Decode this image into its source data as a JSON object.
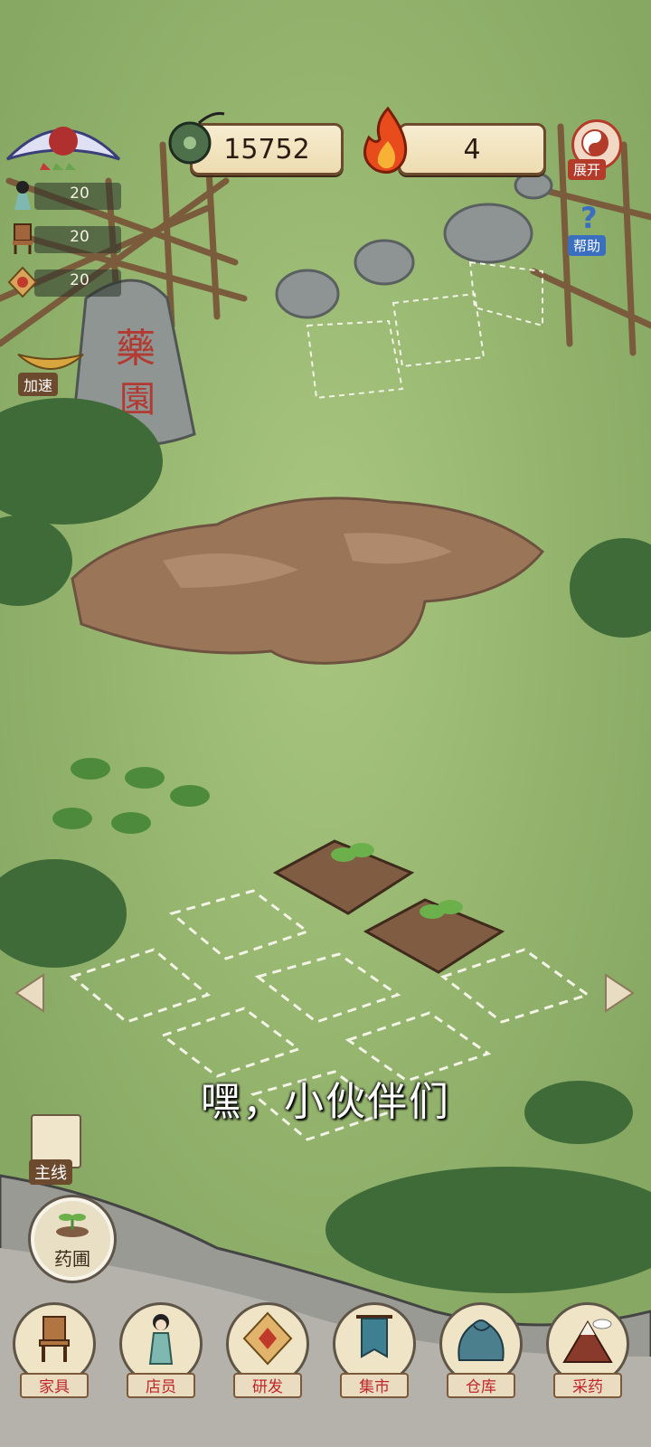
{
  "hud": {
    "coins": "15752",
    "energy": "4",
    "expand_label": "展开",
    "help_label": "帮助"
  },
  "stats": [
    {
      "icon": "girl-icon",
      "value": "20"
    },
    {
      "icon": "chair-icon",
      "value": "20"
    },
    {
      "icon": "parcel-icon",
      "value": "20"
    }
  ],
  "speedup_label": "加速",
  "stone_sign": "藥園",
  "dialogue": "嘿，小伙伴们",
  "side": {
    "main_quest_label": "主线",
    "herb_garden_label": "药圃"
  },
  "nav": [
    {
      "label": "家具",
      "icon": "chair-icon"
    },
    {
      "label": "店员",
      "icon": "shop-assistant-icon"
    },
    {
      "label": "研发",
      "icon": "research-parcel-icon"
    },
    {
      "label": "集市",
      "icon": "market-banner-icon"
    },
    {
      "label": "仓库",
      "icon": "warehouse-bag-icon"
    },
    {
      "label": "采药",
      "icon": "mountain-icon"
    }
  ],
  "colors": {
    "grass": "#8fb06a",
    "soil": "#8a6548",
    "pill_bg": "#f2e4bf",
    "label_red": "#c0262a"
  }
}
